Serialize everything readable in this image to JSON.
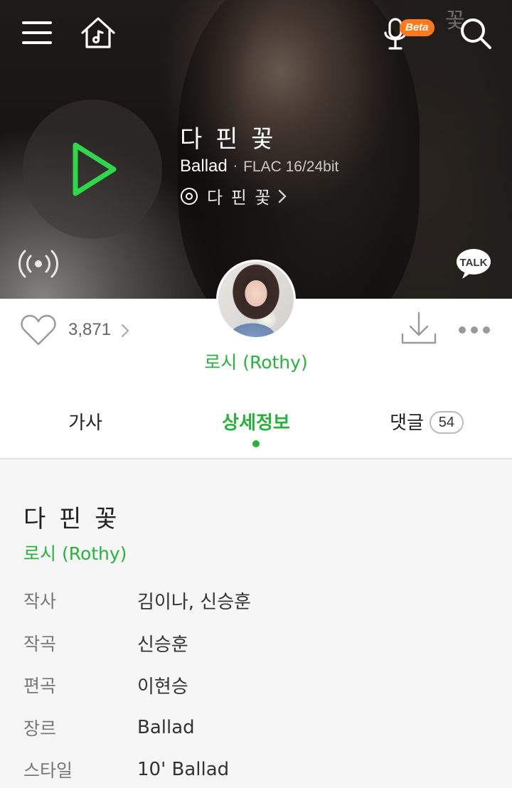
{
  "header": {
    "beta_badge": "Beta",
    "decor_char": "꽃"
  },
  "song": {
    "title": "다 핀 꽃",
    "genre": "Ballad",
    "separator": "·",
    "quality": "FLAC 16/24bit",
    "album": "다 핀 꽃"
  },
  "actions": {
    "like_count": "3,871",
    "artist": "로시 (Rothy)"
  },
  "tabs": {
    "lyrics": "가사",
    "detail": "상세정보",
    "comments": "댓글",
    "comment_count": "54",
    "active": "상세정보"
  },
  "detail": {
    "title": "다 핀 꽃",
    "artist": "로시 (Rothy)",
    "rows": [
      {
        "label": "작사",
        "value": "김이나, 신승훈"
      },
      {
        "label": "작곡",
        "value": "신승훈"
      },
      {
        "label": "편곡",
        "value": "이현승"
      },
      {
        "label": "장르",
        "value": "Ballad"
      },
      {
        "label": "스타일",
        "value": "10' Ballad"
      }
    ]
  },
  "colors": {
    "accent": "#27b33b",
    "beta_badge": "#ff7a1a"
  },
  "icons": [
    "menu-icon",
    "home-music-icon",
    "voice-mic-icon",
    "search-icon",
    "play-icon",
    "album-disc-icon",
    "chevron-right-icon",
    "radio-broadcast-icon",
    "kakao-talk-icon",
    "heart-icon",
    "download-icon",
    "more-icon"
  ]
}
